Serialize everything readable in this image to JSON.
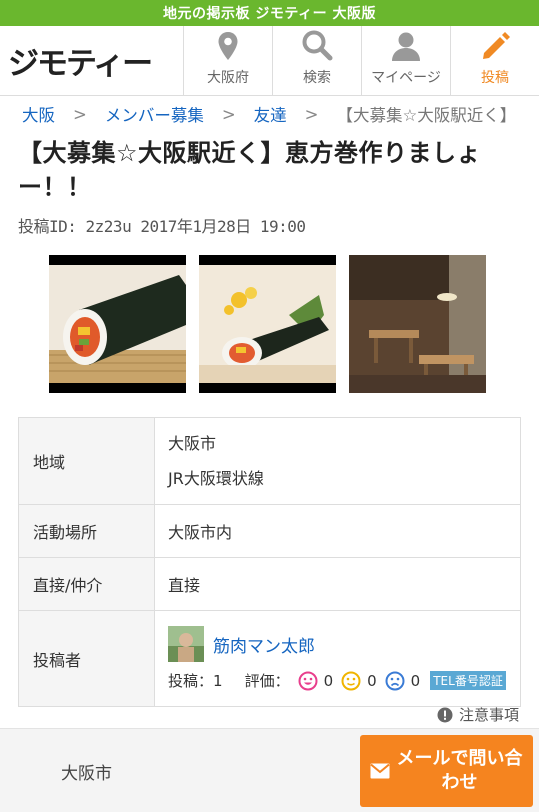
{
  "topbar": {
    "text": "地元の掲示板 ジモティー 大阪版"
  },
  "header": {
    "logo": "ジモティー",
    "nav": [
      {
        "label": "大阪府",
        "icon": "location-pin-icon"
      },
      {
        "label": "検索",
        "icon": "search-icon"
      },
      {
        "label": "マイページ",
        "icon": "user-icon"
      },
      {
        "label": "投稿",
        "icon": "pencil-icon"
      }
    ]
  },
  "breadcrumb": {
    "items": [
      "大阪",
      "メンバー募集",
      "友達"
    ],
    "separator": ">",
    "current": "【大募集☆大阪駅近く】"
  },
  "post": {
    "title": "【大募集☆大阪駅近く】恵方巻作りましょー！！",
    "meta": "投稿ID: 2z23u  2017年1月28日 19:00"
  },
  "gallery": [
    {
      "alt": "ehomaki-sushi-roll-photo"
    },
    {
      "alt": "ehomaki-with-flowers-photo"
    },
    {
      "alt": "cafe-interior-photo"
    }
  ],
  "details": {
    "area_label": "地域",
    "area_city": "大阪市",
    "area_line": "JR大阪環状線",
    "place_label": "活動場所",
    "place_value": "大阪市内",
    "direct_label": "直接/仲介",
    "direct_value": "直接",
    "poster_label": "投稿者",
    "poster_name": "筋肉マン太郎",
    "posts_label": "投稿：",
    "posts_count": "1",
    "rating_label": "評価：",
    "rating_good": "0",
    "rating_normal": "0",
    "rating_bad": "0",
    "tel_badge": "TEL番号認証"
  },
  "notice": {
    "label": "注意事項"
  },
  "footer": {
    "area": "大阪市",
    "mail_button": "メールで問い合わせ"
  },
  "colors": {
    "brand_green": "#6ab72e",
    "link_blue": "#1565c0",
    "accent_orange": "#f5841f",
    "good_pink": "#e83e8c",
    "normal_yellow": "#f0b400",
    "bad_blue": "#3a7bd5"
  }
}
